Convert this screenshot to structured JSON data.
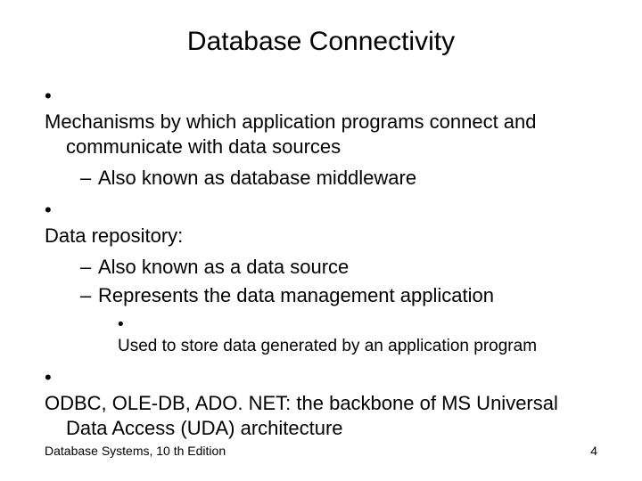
{
  "title": "Database Connectivity",
  "bullets": {
    "b1": "Mechanisms by which application programs connect and communicate with data sources",
    "b1a": "Also known as database middleware",
    "b2": "Data repository:",
    "b2a": "Also known as a data source",
    "b2b": "Represents the data management application",
    "b2b1": "Used to store data generated by an application program",
    "b3": "ODBC, OLE-DB, ADO. NET: the backbone of MS Universal Data Access (UDA) architecture"
  },
  "footer": {
    "left": "Database Systems, 10 th Edition",
    "right": "4"
  }
}
